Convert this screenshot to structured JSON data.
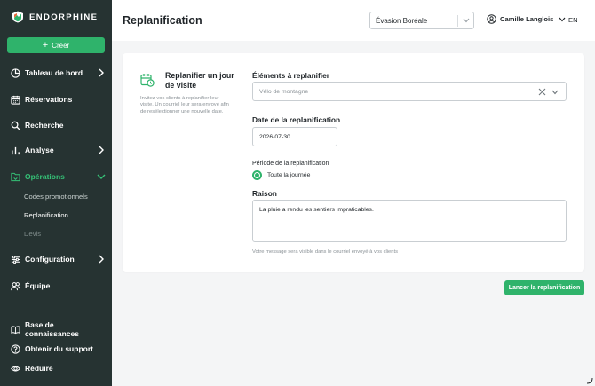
{
  "brand": {
    "name": "ENDORPHINE",
    "accent": "#2fb36b",
    "sidebar_bg": "#263332"
  },
  "sidebar": {
    "create_label": "Créer",
    "nav": [
      {
        "label": "Tableau de bord",
        "icon": "pie-chart-icon"
      },
      {
        "label": "Réservations",
        "icon": "calendar-icon"
      },
      {
        "label": "Recherche",
        "icon": "search-icon"
      },
      {
        "label": "Analyse",
        "icon": "bar-chart-icon"
      },
      {
        "label": "Opérations",
        "icon": "operations-icon"
      },
      {
        "label": "Configuration",
        "icon": "sliders-icon"
      },
      {
        "label": "Équipe",
        "icon": "team-icon"
      }
    ],
    "sub_items": [
      "Codes promotionnels",
      "Replanification",
      "Devis"
    ],
    "footer": [
      {
        "label": "Base de connaissances",
        "icon": "book-icon"
      },
      {
        "label": "Obtenir du support",
        "icon": "help-icon"
      },
      {
        "label": "Réduire",
        "icon": "eye-icon"
      }
    ]
  },
  "header": {
    "title": "Replanification",
    "org_selected": "Évasion Boréale",
    "user_name": "Camille Langlois",
    "language": "EN"
  },
  "card": {
    "title": "Replanifier un jour de visite",
    "description": "Invitez vos clients à replanifier leur visite. Un courriel leur sera envoyé afin de resélectionner une nouvelle date."
  },
  "form": {
    "items_label": "Éléments à replanifier",
    "items_value": "Vélo de montagne",
    "date_label": "Date de la replanification",
    "date_value": "2026-07-30",
    "period_label": "Période de la replanification",
    "period_option": "Toute la journée",
    "reason_label": "Raison",
    "reason_value": "La pluie a rendu les sentiers impraticables.",
    "help_text": "Votre message sera visible dans le courriel envoyé à vos clients"
  },
  "actions": {
    "submit_label": "Lancer la replanification"
  }
}
